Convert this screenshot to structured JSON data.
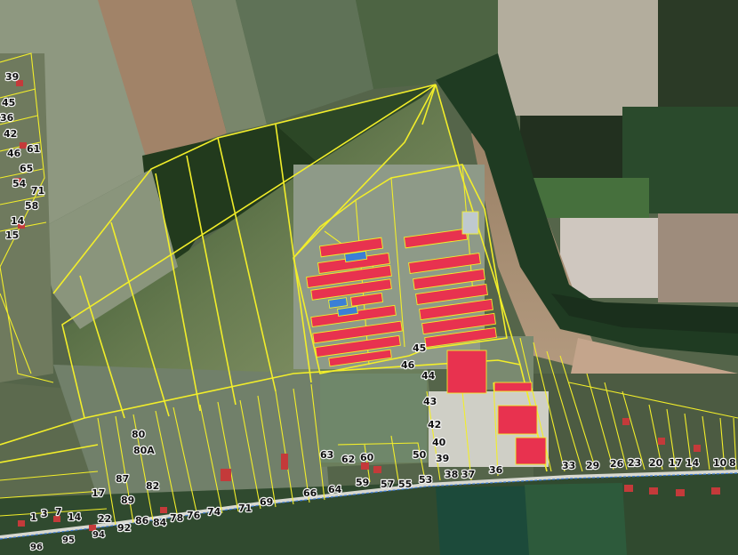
{
  "map": {
    "type": "cadastral parcel overlay on satellite imagery",
    "colors": {
      "parcel_outline": "#f2ee2a",
      "building_red": "#e8324f",
      "building_blue": "#3b7fd6",
      "boundary_dashed": "#3c7bd8",
      "field_dark": "#27401f",
      "field_light": "#a9b39a"
    },
    "parcel_labels": {
      "p39": "39",
      "p45": "45",
      "p36": "36",
      "p42": "42",
      "p61": "61",
      "p46": "46",
      "p65": "65",
      "p54": "54",
      "p71a": "71",
      "p58": "58",
      "p14a": "14",
      "p15": "15",
      "p80": "80",
      "p80A": "80A",
      "p87": "87",
      "p82": "82",
      "p17a": "17",
      "p89": "89",
      "p1": "1",
      "p3": "3",
      "p7": "7",
      "p14b": "14",
      "p22": "22",
      "p92": "92",
      "p86": "86",
      "p84": "84",
      "p78": "78",
      "p76": "76",
      "p74": "74",
      "p71b": "71",
      "p69": "69",
      "p66": "66",
      "p64": "64",
      "p63": "63",
      "p62": "62",
      "p60": "60",
      "p59": "59",
      "p57": "57",
      "p55": "55",
      "p53": "53",
      "p50": "50",
      "p39b": "39",
      "p38": "38",
      "p37": "37",
      "p36b": "36",
      "p40": "40",
      "p42b": "42",
      "p43": "43",
      "p44": "44",
      "p46b": "46",
      "p45b": "45",
      "p33": "33",
      "p29": "29",
      "p26": "26",
      "p23": "23",
      "p20": "20",
      "p17b": "17",
      "p14c": "14",
      "p10": "10",
      "p8": "8",
      "p96": "96",
      "p95": "95",
      "p94": "94"
    }
  }
}
